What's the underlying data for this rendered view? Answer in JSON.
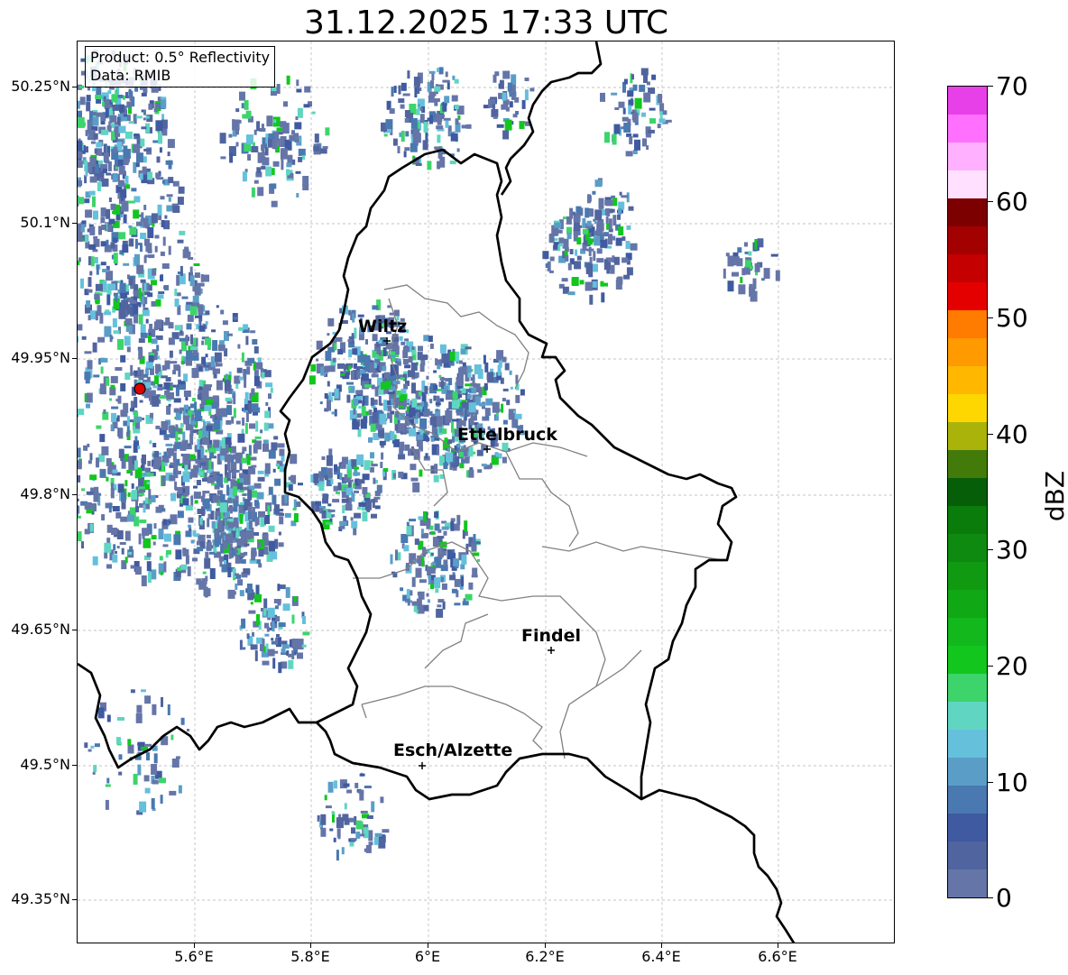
{
  "title": "31.12.2025 17:33 UTC",
  "info_box": {
    "product": "Product: 0.5° Reflectivity",
    "data_source": "Data: RMIB"
  },
  "latitude_labels": [
    "50.25°N",
    "50.1°N",
    "49.95°N",
    "49.8°N",
    "49.65°N",
    "49.5°N",
    "49.35°N"
  ],
  "longitude_labels": [
    "5.6°E",
    "5.8°E",
    "6°E",
    "6.2°E",
    "6.4°E",
    "6.6°E"
  ],
  "cities": [
    {
      "name": "Wiltz",
      "lat": 49.97,
      "lon": 5.93
    },
    {
      "name": "Ettelbruck",
      "lat": 49.85,
      "lon": 6.1
    },
    {
      "name": "Findel",
      "lat": 49.63,
      "lon": 6.21
    },
    {
      "name": "Esch/Alzette",
      "lat": 49.5,
      "lon": 5.99
    }
  ],
  "radar_site": {
    "lat": 49.915,
    "lon": 5.505,
    "color": "#e00000"
  },
  "colorbar": {
    "unit": "dBZ",
    "min": 0,
    "max": 70,
    "tick_labels": [
      "0",
      "10",
      "20",
      "30",
      "40",
      "50",
      "60",
      "70"
    ],
    "colors": [
      "#6575a8",
      "#50649f",
      "#3f5aa0",
      "#4a78b0",
      "#5a9ec8",
      "#65c0dc",
      "#5fd5c2",
      "#3dd46b",
      "#12c61e",
      "#12b81c",
      "#11a815",
      "#109a12",
      "#0e8a10",
      "#0a7c0c",
      "#075e08",
      "#437b0a",
      "#aab30a",
      "#ffd700",
      "#ffb700",
      "#ff9a00",
      "#ff7c00",
      "#e50000",
      "#c40000",
      "#a30000",
      "#7c0000",
      "#ffe0ff",
      "#ffb0ff",
      "#ff70ff",
      "#e840e8"
    ]
  },
  "colors": {
    "border": "#000000",
    "canton_line": "#808080",
    "grid": "#b0b0b0"
  }
}
